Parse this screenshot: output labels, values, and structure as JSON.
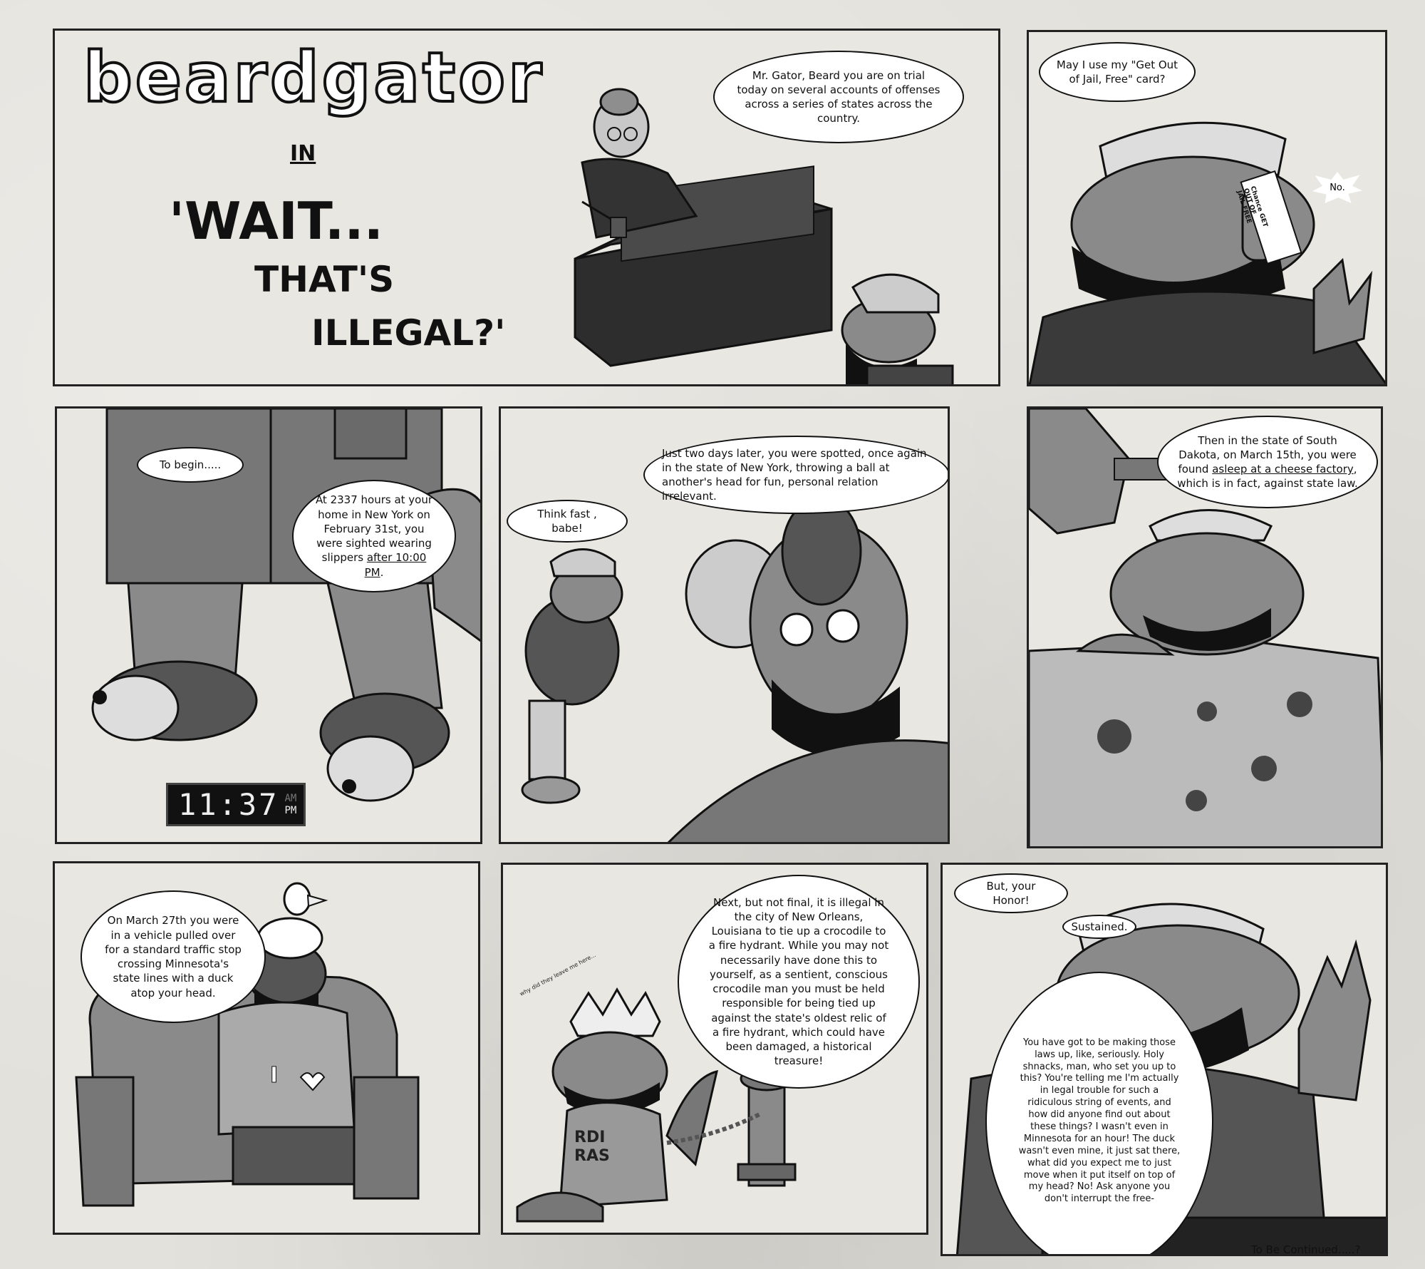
{
  "comic": {
    "title_logo": "beardgator",
    "title_in": "IN",
    "title_line1": "'WAIT...",
    "title_line2": "THAT'S",
    "title_line3": "ILLEGAL?'",
    "footer": "To Be Continued.....?"
  },
  "panel1": {
    "judge_speech": "Mr. Gator, Beard you are on trial today on several accounts of offenses across a series of states across the country."
  },
  "panel2": {
    "gator_speech": "May I use my \"Get Out of Jail, Free\" card?",
    "judge_reply": "No.",
    "card_text": "GET OUT OF JAIL FREE",
    "card_brand": "Chance"
  },
  "panel3": {
    "speech1": "To begin.....",
    "speech2_a": "At 2337 hours at your home in New York on February 31st, you were sighted wearing slippers ",
    "speech2_underlined": "after 10:00 PM",
    "speech2_end": ".",
    "clock_time": "11:37",
    "clock_am": "AM",
    "clock_pm": "PM"
  },
  "panel4": {
    "narration": "Just two days later, you were spotted, once again in the state of New York, throwing a ball at another's head for fun, personal relation irrelevant.",
    "gator_speech": "Think fast , babe!"
  },
  "panel5": {
    "speech_a": "Then in the state of South Dakota, on March 15th, you were found ",
    "speech_underlined": "asleep at a cheese factory",
    "speech_end": ", which is in fact, against state law."
  },
  "panel6": {
    "speech": "On March 27th you were in a vehicle pulled over for a standard traffic stop crossing Minnesota's state lines with a duck atop your head.",
    "shirt_text": "I"
  },
  "panel7": {
    "speech": "Next, but not final, it is illegal in the city of New Orleans, Louisiana to tie up a crocodile to a fire hydrant. While you may not necessarily have done this to yourself, as a sentient, conscious crocodile man you must be held responsible for being tied up against the state's oldest relic of a fire hydrant, which could have been damaged, a historical treasure!",
    "whisper": "why did they leave me here...",
    "shirt_text": "RDI RAS"
  },
  "panel8": {
    "gator_speech": "But, your Honor!",
    "judge_speech": "Sustained.",
    "rant": "You have got to be making those laws up, like, seriously. Holy shnacks, man, who set you up to this? You're telling me I'm actually in legal trouble for such a ridiculous string of events, and how did anyone find out about these things? I wasn't even in Minnesota for an hour! The duck wasn't even mine, it just sat there, what did you expect me to just move when it put itself on top of my head? No! Ask anyone you don't interrupt the free-"
  },
  "colors": {
    "ink": "#111111",
    "paper": "#e3e1db",
    "gator_skin": "#8a8a8a",
    "dark_clothing": "#3a3a3a"
  }
}
